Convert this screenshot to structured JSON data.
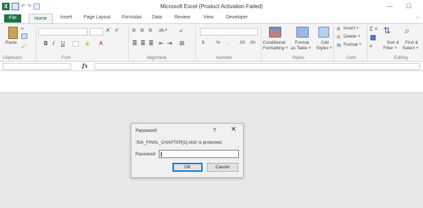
{
  "window": {
    "title": "Microsoft Excel (Product Activation Failed)"
  },
  "quick_access": {
    "undo": "↶",
    "redo": "↷"
  },
  "tabs": [
    {
      "label": "File"
    },
    {
      "label": "Home"
    },
    {
      "label": "Insert"
    },
    {
      "label": "Page Layout"
    },
    {
      "label": "Formulas"
    },
    {
      "label": "Data"
    },
    {
      "label": "Review"
    },
    {
      "label": "View"
    },
    {
      "label": "Developer"
    }
  ],
  "ribbon": {
    "clipboard": {
      "paste": "Paste",
      "group": "Clipboard"
    },
    "font": {
      "group": "Font",
      "bold": "B",
      "italic": "I",
      "underline": "U",
      "grow": "Aˆ",
      "shrink": "Aˇ"
    },
    "alignment": {
      "group": "Alignment"
    },
    "number": {
      "group": "Number",
      "percent": "%",
      "comma": ",",
      "inc": ".00",
      "dec": ".00"
    },
    "styles": {
      "group": "Styles",
      "conditional": "Conditional",
      "conditional2": "Formatting ˅",
      "format_table": "Format",
      "format_table2": "as Table ˅",
      "cell_styles": "Cell",
      "cell_styles2": "Styles ˅"
    },
    "cells": {
      "group": "Cells",
      "insert": "Insert ˅",
      "delete": "Delete ˅",
      "format": "Format ˅"
    },
    "editing": {
      "group": "Editing",
      "sigma": "Σ ˅",
      "sort": "Sort &",
      "sort2": "Filter ˅",
      "find": "Find &",
      "find2": "Select ˅"
    }
  },
  "formula_bar": {
    "fx": "fx"
  },
  "dialog": {
    "title": "Password",
    "help": "?",
    "close": "✕",
    "message": "'SIA_FINAL_CHAPTER[1].xlsb' is protected.",
    "password_label": "Password:",
    "password_value": "",
    "ok": "OK",
    "cancel": "Cancel"
  },
  "colors": {
    "excel_green": "#1f7244",
    "workspace": "#e8e8e8",
    "focus_blue": "#0078d7"
  }
}
